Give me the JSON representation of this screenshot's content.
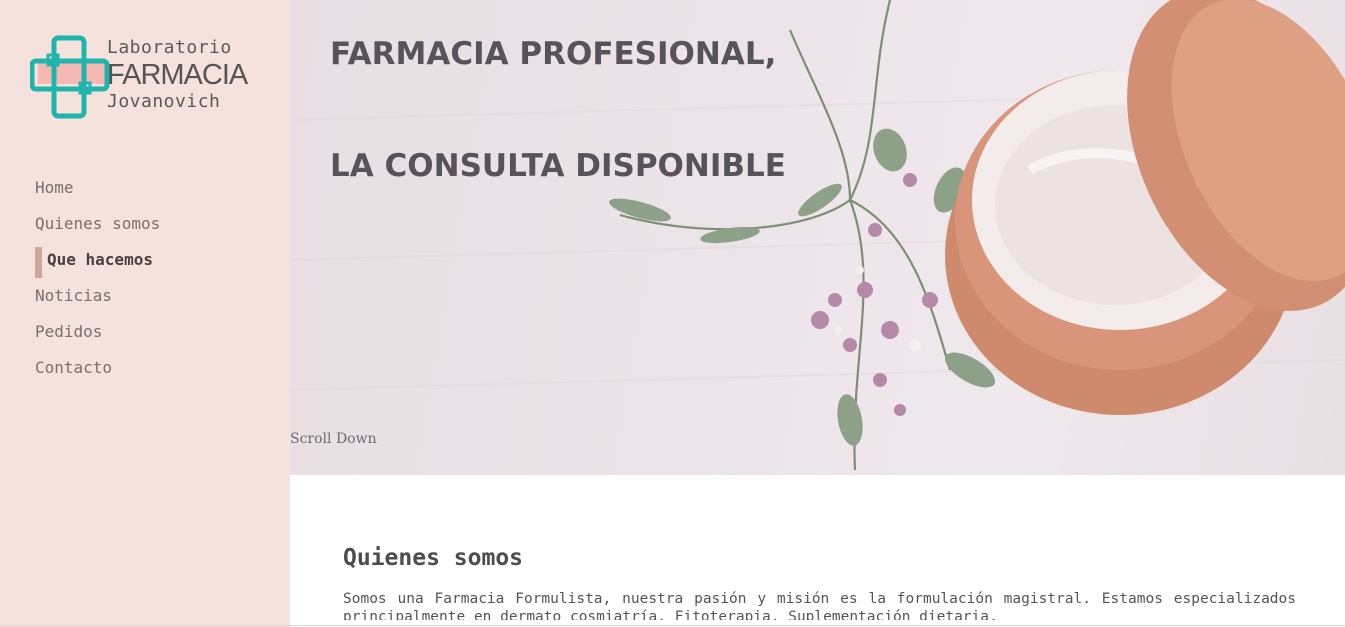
{
  "logo": {
    "line1": "Laboratorio",
    "line2": "FARMACIA",
    "line3": "Jovanovich",
    "cross_color": "#1fb5ad",
    "accent_color": "#f4aaa5"
  },
  "nav": {
    "items": [
      {
        "label": "Home"
      },
      {
        "label": "Quienes somos"
      },
      {
        "label": "Que hacemos"
      },
      {
        "label": "Noticias"
      },
      {
        "label": "Pedidos"
      },
      {
        "label": "Contacto"
      }
    ],
    "active_index": 2
  },
  "hero": {
    "title_line1": "FARMACIA PROFESIONAL,",
    "title_line2": "LA CONSULTA DISPONIBLE",
    "scroll_label": "Scroll Down"
  },
  "about": {
    "heading": "Quienes somos",
    "text": "Somos una Farmacia Formulista, nuestra pasión y misión es la formulación magistral. Estamos especializados principalmente en dermato cosmiatría, Fitoterapia, Suplementación dietaria,"
  },
  "colors": {
    "sidebar_bg": "#f5e2dc",
    "active_marker": "#cba79d",
    "jar": "#d38f74"
  }
}
